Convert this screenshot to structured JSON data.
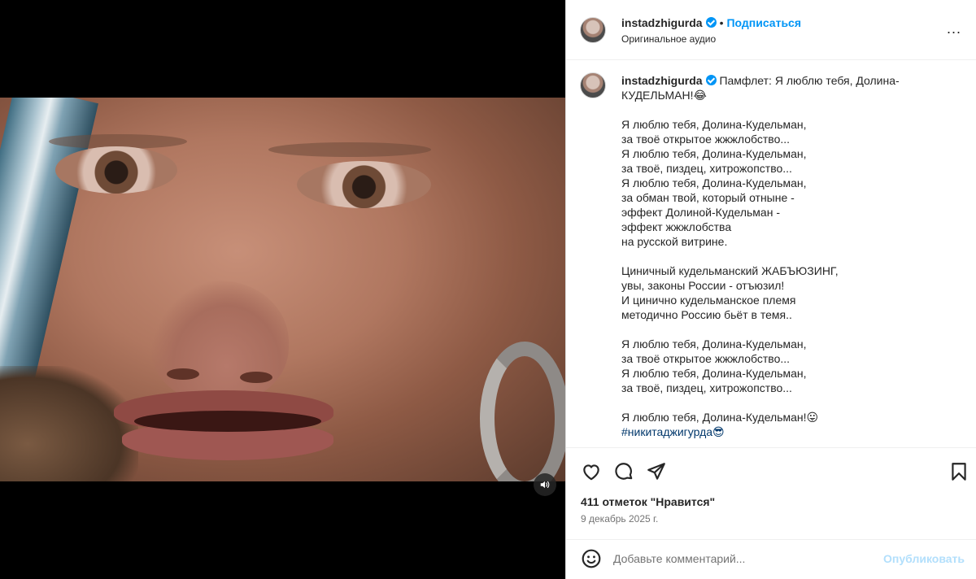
{
  "header": {
    "username": "instadzhigurda",
    "dot": "•",
    "follow_label": "Подписаться",
    "audio": "Оригинальное аудио",
    "more_label": "..."
  },
  "caption": {
    "username": "instadzhigurda",
    "title": "Памфлет: Я люблю тебя, Долина-КУДЕЛЬМАН!😂",
    "stanzas": [
      [
        "Я люблю тебя, Долина-Кудельман,",
        "за твоё открытое жжжлобство...",
        "Я люблю тебя, Долина-Кудельман,",
        "за твоё, пиздец, хитрожопство...",
        "Я люблю тебя, Долина-Кудельман,",
        "за обман твой, который отныне -",
        "эффект Долиной-Кудельман -",
        "эффект жжжлобства",
        "на русской витрине."
      ],
      [
        "Циничный кудельманский ЖАБЪЮЗИНГ,",
        "увы, законы России - отъюзил!",
        "И цинично кудельманское племя",
        "методично Россию бьёт в темя.."
      ],
      [
        "Я люблю тебя, Долина-Кудельман,",
        "за твоё открытое жжжлобство...",
        "Я люблю тебя, Долина-Кудельман,",
        "за твоё, пиздец, хитрожопство..."
      ]
    ],
    "last_line": "Я люблю тебя, Долина-Кудельман!😛",
    "hashtag": "#никитаджигурда😎"
  },
  "actions": {
    "likes": "411 отметок \"Нравится\"",
    "date": "9 декабрь 2025 г."
  },
  "comment": {
    "placeholder": "Добавьте комментарий...",
    "post_label": "Опубликовать"
  },
  "colors": {
    "accent": "#0095f6",
    "post_disabled": "#b2dffc",
    "hashtag": "#00376b"
  }
}
